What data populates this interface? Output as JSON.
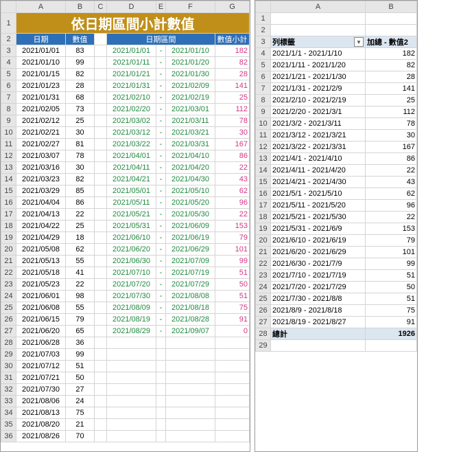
{
  "left": {
    "cols": [
      "A",
      "B",
      "C",
      "D",
      "E",
      "F",
      "G"
    ],
    "title": "依日期區間小計數值",
    "headers": {
      "date": "日期",
      "value": "數值",
      "range": "日期區間",
      "subtotal": "數值小計"
    },
    "dates": [
      {
        "d": "2021/01/01",
        "v": 83
      },
      {
        "d": "2021/01/10",
        "v": 99
      },
      {
        "d": "2021/01/15",
        "v": 82
      },
      {
        "d": "2021/01/23",
        "v": 28
      },
      {
        "d": "2021/01/31",
        "v": 68
      },
      {
        "d": "2021/02/05",
        "v": 73
      },
      {
        "d": "2021/02/12",
        "v": 25
      },
      {
        "d": "2021/02/21",
        "v": 30
      },
      {
        "d": "2021/02/27",
        "v": 81
      },
      {
        "d": "2021/03/07",
        "v": 78
      },
      {
        "d": "2021/03/16",
        "v": 30
      },
      {
        "d": "2021/03/23",
        "v": 82
      },
      {
        "d": "2021/03/29",
        "v": 85
      },
      {
        "d": "2021/04/04",
        "v": 86
      },
      {
        "d": "2021/04/13",
        "v": 22
      },
      {
        "d": "2021/04/22",
        "v": 25
      },
      {
        "d": "2021/04/29",
        "v": 18
      },
      {
        "d": "2021/05/08",
        "v": 62
      },
      {
        "d": "2021/05/13",
        "v": 55
      },
      {
        "d": "2021/05/18",
        "v": 41
      },
      {
        "d": "2021/05/23",
        "v": 22
      },
      {
        "d": "2021/06/01",
        "v": 98
      },
      {
        "d": "2021/06/08",
        "v": 55
      },
      {
        "d": "2021/06/15",
        "v": 79
      },
      {
        "d": "2021/06/20",
        "v": 65
      },
      {
        "d": "2021/06/28",
        "v": 36
      },
      {
        "d": "2021/07/03",
        "v": 99
      },
      {
        "d": "2021/07/12",
        "v": 51
      },
      {
        "d": "2021/07/21",
        "v": 50
      },
      {
        "d": "2021/07/30",
        "v": 27
      },
      {
        "d": "2021/08/06",
        "v": 24
      },
      {
        "d": "2021/08/13",
        "v": 75
      },
      {
        "d": "2021/08/20",
        "v": 21
      },
      {
        "d": "2021/08/26",
        "v": 70
      }
    ],
    "ranges": [
      {
        "s": "2021/01/01",
        "e": "2021/01/10",
        "t": 182
      },
      {
        "s": "2021/01/11",
        "e": "2021/01/20",
        "t": 82
      },
      {
        "s": "2021/01/21",
        "e": "2021/01/30",
        "t": 28
      },
      {
        "s": "2021/01/31",
        "e": "2021/02/09",
        "t": 141
      },
      {
        "s": "2021/02/10",
        "e": "2021/02/19",
        "t": 25
      },
      {
        "s": "2021/02/20",
        "e": "2021/03/01",
        "t": 112
      },
      {
        "s": "2021/03/02",
        "e": "2021/03/11",
        "t": 78
      },
      {
        "s": "2021/03/12",
        "e": "2021/03/21",
        "t": 30
      },
      {
        "s": "2021/03/22",
        "e": "2021/03/31",
        "t": 167
      },
      {
        "s": "2021/04/01",
        "e": "2021/04/10",
        "t": 86
      },
      {
        "s": "2021/04/11",
        "e": "2021/04/20",
        "t": 22
      },
      {
        "s": "2021/04/21",
        "e": "2021/04/30",
        "t": 43
      },
      {
        "s": "2021/05/01",
        "e": "2021/05/10",
        "t": 62
      },
      {
        "s": "2021/05/11",
        "e": "2021/05/20",
        "t": 96
      },
      {
        "s": "2021/05/21",
        "e": "2021/05/30",
        "t": 22
      },
      {
        "s": "2021/05/31",
        "e": "2021/06/09",
        "t": 153
      },
      {
        "s": "2021/06/10",
        "e": "2021/06/19",
        "t": 79
      },
      {
        "s": "2021/06/20",
        "e": "2021/06/29",
        "t": 101
      },
      {
        "s": "2021/06/30",
        "e": "2021/07/09",
        "t": 99
      },
      {
        "s": "2021/07/10",
        "e": "2021/07/19",
        "t": 51
      },
      {
        "s": "2021/07/20",
        "e": "2021/07/29",
        "t": 50
      },
      {
        "s": "2021/07/30",
        "e": "2021/08/08",
        "t": 51
      },
      {
        "s": "2021/08/09",
        "e": "2021/08/18",
        "t": 75
      },
      {
        "s": "2021/08/19",
        "e": "2021/08/28",
        "t": 91
      },
      {
        "s": "2021/08/29",
        "e": "2021/09/07",
        "t": 0
      }
    ],
    "dash": "-"
  },
  "right": {
    "cols": [
      "A",
      "B"
    ],
    "rowLabel": "列標籤",
    "sumLabel": "加總 - 數值2",
    "rows": [
      {
        "r": "2021/1/1 - 2021/1/10",
        "v": 182
      },
      {
        "r": "2021/1/11 - 2021/1/20",
        "v": 82
      },
      {
        "r": "2021/1/21 - 2021/1/30",
        "v": 28
      },
      {
        "r": "2021/1/31 - 2021/2/9",
        "v": 141
      },
      {
        "r": "2021/2/10 - 2021/2/19",
        "v": 25
      },
      {
        "r": "2021/2/20 - 2021/3/1",
        "v": 112
      },
      {
        "r": "2021/3/2 - 2021/3/11",
        "v": 78
      },
      {
        "r": "2021/3/12 - 2021/3/21",
        "v": 30
      },
      {
        "r": "2021/3/22 - 2021/3/31",
        "v": 167
      },
      {
        "r": "2021/4/1 - 2021/4/10",
        "v": 86
      },
      {
        "r": "2021/4/11 - 2021/4/20",
        "v": 22
      },
      {
        "r": "2021/4/21 - 2021/4/30",
        "v": 43
      },
      {
        "r": "2021/5/1 - 2021/5/10",
        "v": 62
      },
      {
        "r": "2021/5/11 - 2021/5/20",
        "v": 96
      },
      {
        "r": "2021/5/21 - 2021/5/30",
        "v": 22
      },
      {
        "r": "2021/5/31 - 2021/6/9",
        "v": 153
      },
      {
        "r": "2021/6/10 - 2021/6/19",
        "v": 79
      },
      {
        "r": "2021/6/20 - 2021/6/29",
        "v": 101
      },
      {
        "r": "2021/6/30 - 2021/7/9",
        "v": 99
      },
      {
        "r": "2021/7/10 - 2021/7/19",
        "v": 51
      },
      {
        "r": "2021/7/20 - 2021/7/29",
        "v": 50
      },
      {
        "r": "2021/7/30 - 2021/8/8",
        "v": 51
      },
      {
        "r": "2021/8/9 - 2021/8/18",
        "v": 75
      },
      {
        "r": "2021/8/19 - 2021/8/27",
        "v": 91
      }
    ],
    "totalLabel": "總計",
    "totalValue": 1926
  }
}
